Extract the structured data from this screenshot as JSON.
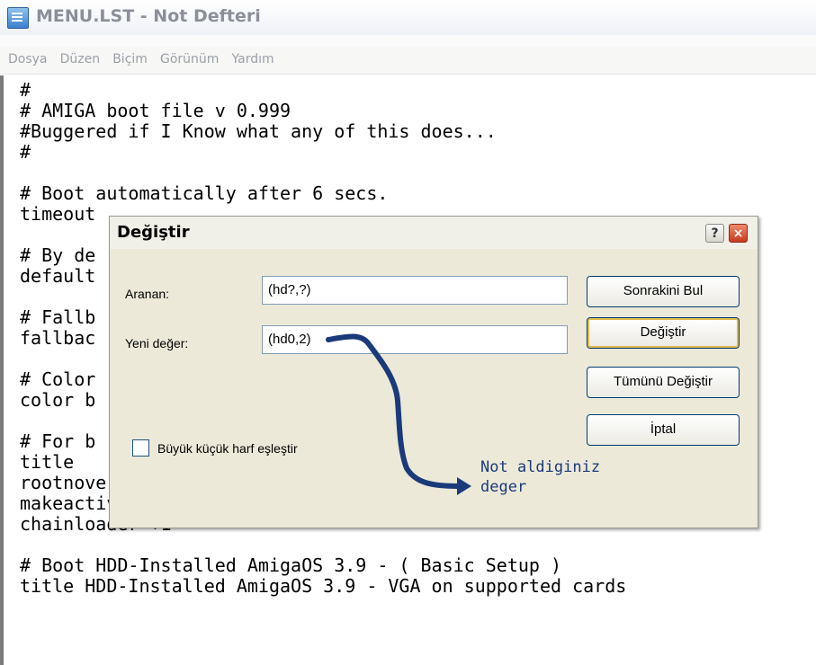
{
  "window": {
    "title": "MENU.LST - Not Defteri"
  },
  "menu": [
    "Dosya",
    "Düzen",
    "Biçim",
    "Görünüm",
    "Yardım"
  ],
  "editor": {
    "text": "#\n# AMIGA boot file v 0.999\n#Buggered if I Know what any of this does...\n#\n\n# Boot automatically after 6 secs.\ntimeout\n\n# By de\ndefault\n\n# Fallb\nfallbac\n\n# Color\ncolor b\n\n# For b                                            titio\ntitle\nrootnoverify     (hd0,0)\nmakeactive\nchainloader +1\n\n# Boot HDD-Installed AmigaOS 3.9 - ( Basic Setup )\ntitle HDD-Installed AmigaOS 3.9 - VGA on supported cards"
  },
  "dialog": {
    "title": "Değiştir",
    "help_icon": "?",
    "close_icon": "×",
    "search_label": "Aranan:",
    "search_value": "(hd?,?)",
    "replace_label": "Yeni değer:",
    "replace_value": "(hd0,2)",
    "buttons": {
      "find_next": "Sonrakini Bul",
      "replace": "Değiştir",
      "replace_all": "Tümünü Değiştir",
      "cancel": "İptal"
    },
    "match_case_label": "Büyük küçük harf eşleştir",
    "match_case_checked": false
  },
  "annotation": {
    "text": "Not aldiginiz\ndeger",
    "color": "#1a3a7a"
  }
}
